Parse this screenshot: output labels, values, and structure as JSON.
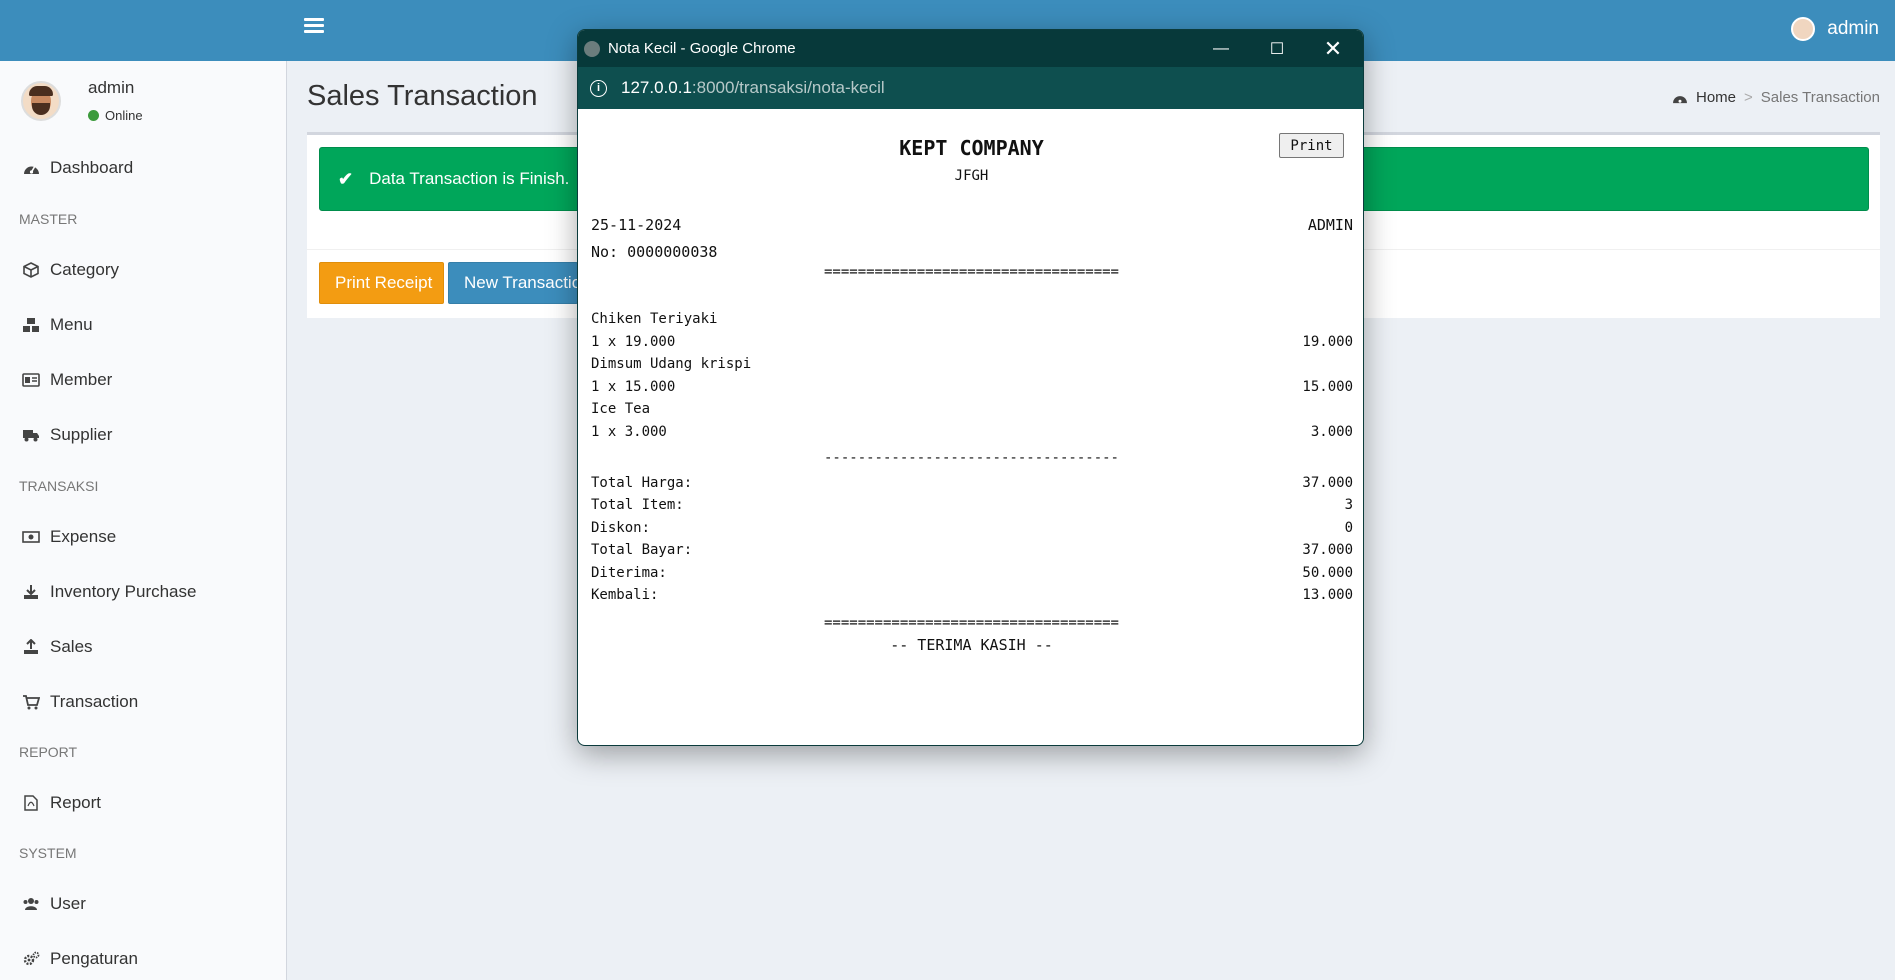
{
  "header": {
    "username": "admin"
  },
  "sidebar": {
    "user": {
      "name": "admin",
      "status": "Online"
    },
    "items": [
      {
        "label": "Dashboard",
        "icon": "dashboard-icon"
      },
      {
        "section": "MASTER"
      },
      {
        "label": "Category",
        "icon": "cube-icon"
      },
      {
        "label": "Menu",
        "icon": "cubes-icon"
      },
      {
        "label": "Member",
        "icon": "id-card-icon"
      },
      {
        "label": "Supplier",
        "icon": "truck-icon"
      },
      {
        "section": "TRANSAKSI"
      },
      {
        "label": "Expense",
        "icon": "money-icon"
      },
      {
        "label": "Inventory Purchase",
        "icon": "download-icon"
      },
      {
        "label": "Sales",
        "icon": "upload-icon"
      },
      {
        "label": "Transaction",
        "icon": "cart-icon"
      },
      {
        "section": "REPORT"
      },
      {
        "label": "Report",
        "icon": "file-pdf-icon"
      },
      {
        "section": "SYSTEM"
      },
      {
        "label": "User",
        "icon": "users-icon"
      },
      {
        "label": "Pengaturan",
        "icon": "cogs-icon"
      }
    ]
  },
  "main": {
    "title": "Sales Transaction",
    "breadcrumb": {
      "home": "Home",
      "current": "Sales Transaction"
    },
    "alert": "Data Transaction is Finish.",
    "print_button": "Print Receipt",
    "new_button": "New Transaction"
  },
  "popup": {
    "window_title": "Nota Kecil - Google Chrome",
    "url_host": "127.0.0.1",
    "url_path": ":8000/transaksi/nota-kecil",
    "receipt": {
      "company": "KEPT COMPANY",
      "subtitle": "JFGH",
      "print_label": "Print",
      "date": "25-11-2024",
      "cashier": "ADMIN",
      "number": "No: 0000000038",
      "separator_double": "===================================",
      "separator_single": "-----------------------------------",
      "items": [
        {
          "name": "Chiken Teriyaki",
          "qty_price": "1 x 19.000",
          "subtotal": "19.000"
        },
        {
          "name": "Dimsum Udang krispi",
          "qty_price": "1 x 15.000",
          "subtotal": "15.000"
        },
        {
          "name": "Ice Tea",
          "qty_price": "1 x 3.000",
          "subtotal": "3.000"
        }
      ],
      "summary": [
        {
          "label": "Total Harga:",
          "value": "37.000"
        },
        {
          "label": "Total Item:",
          "value": "3"
        },
        {
          "label": "Diskon:",
          "value": "0"
        },
        {
          "label": "Total Bayar:",
          "value": "37.000"
        },
        {
          "label": "Diterima:",
          "value": "50.000"
        },
        {
          "label": "Kembali:",
          "value": "13.000"
        }
      ],
      "thanks": "-- TERIMA KASIH --"
    }
  },
  "colors": {
    "header": "#3c8dbc",
    "success": "#00a65a",
    "warning": "#f39c12",
    "primary": "#3c8dbc"
  }
}
